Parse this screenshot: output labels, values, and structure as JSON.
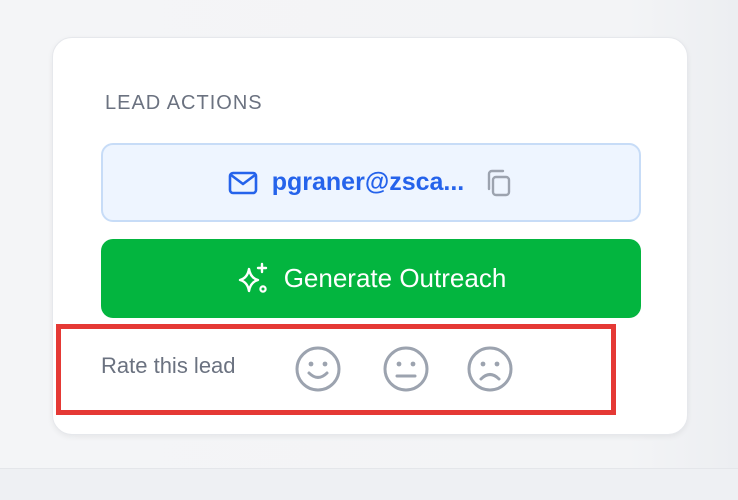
{
  "lead_actions": {
    "title": "LEAD ACTIONS",
    "email_button": {
      "label": "pgraner@zsca...",
      "icon": "mail-icon",
      "copy_icon": "copy-icon"
    },
    "generate_button": {
      "label": "Generate Outreach",
      "icon": "sparkles-icon"
    },
    "rating": {
      "label": "Rate this lead",
      "options": [
        "happy-face-icon",
        "neutral-face-icon",
        "sad-face-icon"
      ]
    }
  },
  "colors": {
    "email_text": "#2563eb",
    "email_bg": "#eef5ff",
    "generate_bg": "#03b53f",
    "highlight_border": "#e53935",
    "muted_text": "#6b7280"
  }
}
